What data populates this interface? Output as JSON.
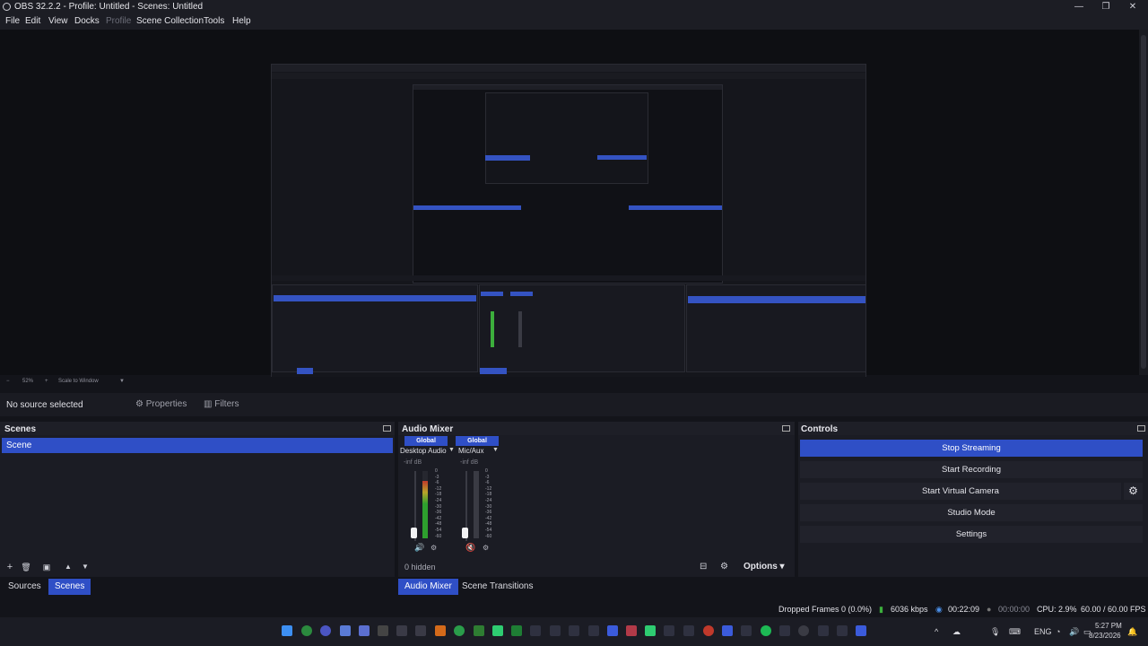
{
  "window": {
    "title": "OBS 32.2.2 - Profile: Untitled - Scenes: Untitled",
    "controls": [
      "—",
      "❐",
      "✕"
    ]
  },
  "menu": [
    "File",
    "Edit",
    "View",
    "Docks",
    "Profile",
    "Scene Collection",
    "Tools",
    "Help"
  ],
  "preview": {
    "zoom": "52%",
    "scale_mode": "Scale to Window"
  },
  "context_bar": {
    "no_source": "No source selected",
    "properties": "Properties",
    "filters": "Filters"
  },
  "scenes_dock": {
    "title": "Scenes",
    "items": [
      "Scene"
    ],
    "toolbar": [
      "+",
      "🗑",
      "▣",
      "▲",
      "▼"
    ]
  },
  "bottom_tabs_left": [
    "Sources",
    "Scenes"
  ],
  "audio_mixer": {
    "title": "Audio Mixer",
    "channels": [
      {
        "global": "Global",
        "name": "Desktop Audio",
        "db": "-inf dB"
      },
      {
        "global": "Global",
        "name": "Mic/Aux",
        "db": "-inf dB"
      }
    ],
    "scale": [
      "0",
      "-3",
      "-6",
      "-12",
      "-18",
      "-24",
      "-30",
      "-36",
      "-42",
      "-48",
      "-54",
      "-60"
    ],
    "hidden": "0 hidden",
    "options": "Options",
    "level_fraction": 0.85
  },
  "bottom_tabs_mid": [
    "Audio Mixer",
    "Scene Transitions"
  ],
  "controls": {
    "title": "Controls",
    "buttons": [
      "Stop Streaming",
      "Start Recording",
      "Start Virtual Camera",
      "Studio Mode",
      "Settings"
    ]
  },
  "status": {
    "dropped_frames": "Dropped Frames 0 (0.0%)",
    "bitrate": "6036 kbps",
    "stream_time": "00:22:09",
    "rec_time": "00:00:00",
    "cpu": "CPU: 2.9%",
    "fps": "60.00 / 60.00 FPS"
  },
  "tray": {
    "lang": "ENG",
    "time": "5:27 PM",
    "date": "8/23/2026"
  },
  "colors": {
    "accent": "#2f4fc6",
    "background": "#13141a",
    "dock": "#1b1c24"
  }
}
